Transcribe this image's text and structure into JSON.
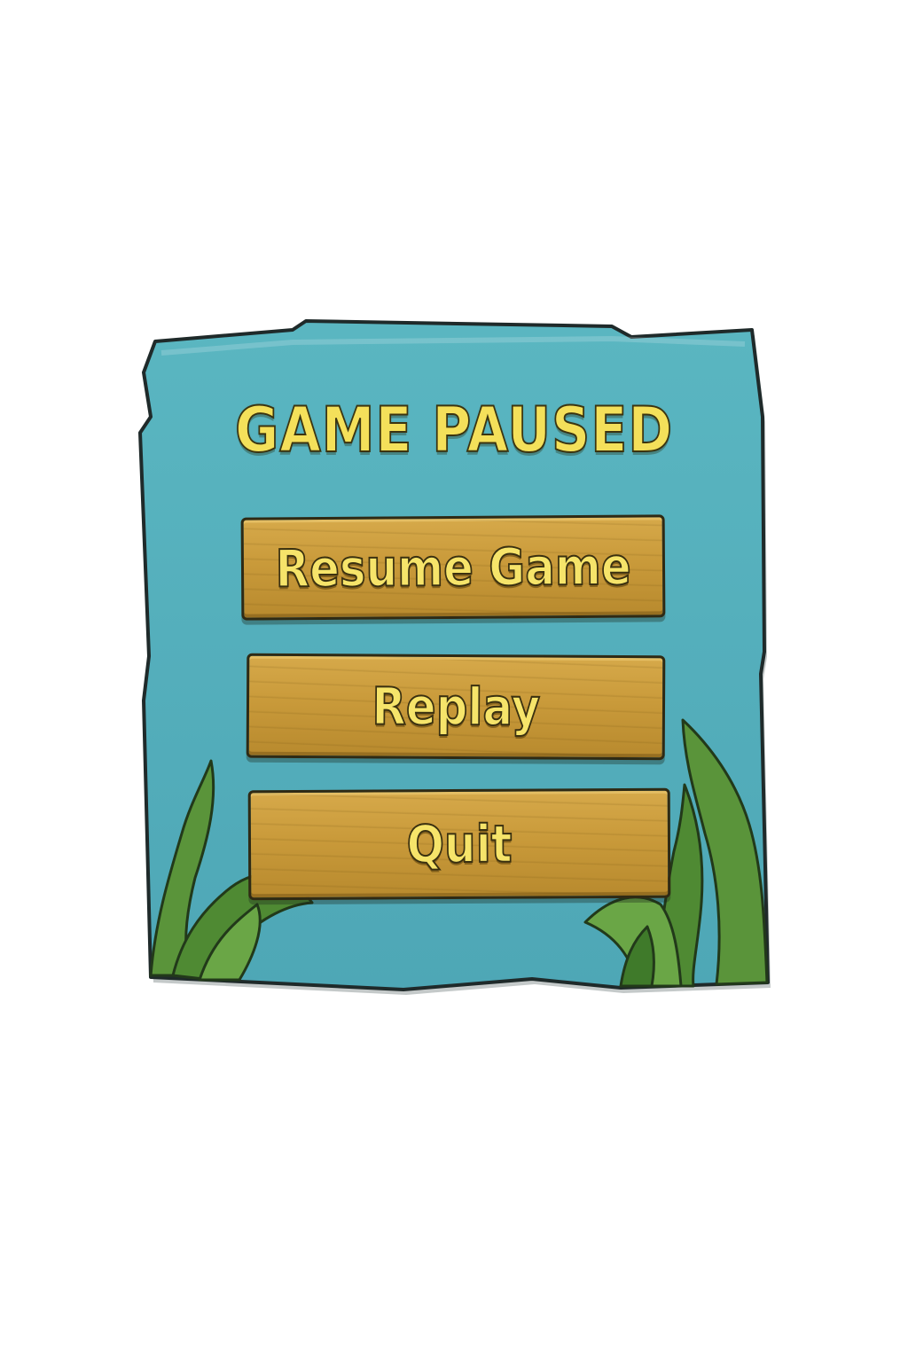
{
  "menu": {
    "title": "GAME PAUSED",
    "buttons": [
      {
        "label": "Resume Game"
      },
      {
        "label": "Replay"
      },
      {
        "label": "Quit"
      }
    ]
  },
  "theme": {
    "panel_color": "#58b3bf",
    "panel_outline": "#1f2a2a",
    "text_color": "#f4e05a",
    "plank_color": "#c99a3a",
    "seaweed_color": "#4f8a33"
  },
  "icons": [
    "seaweed-left-icon",
    "seaweed-right-icon"
  ]
}
